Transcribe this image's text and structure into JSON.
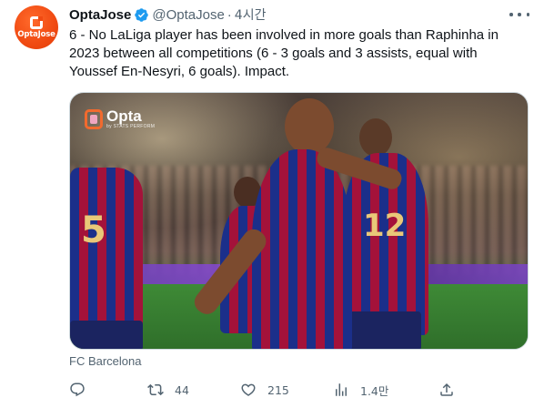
{
  "tweet": {
    "author": {
      "display_name": "OptaJose",
      "handle": "@OptaJose",
      "avatar_label": "OptaJose",
      "verified": true
    },
    "separator": "·",
    "time": "4시간",
    "text": "6 - No LaLiga player has been involved in more goals than Raphinha in 2023 between all competitions (6 - 3 goals and 3 assists, equal with Youssef En-Nesyri, 6 goals). Impact.",
    "media": {
      "logo_text": "Opta",
      "logo_sub": "by STATS PERFORM",
      "caption": "FC Barcelona"
    },
    "actions": {
      "reply": {
        "icon": "reply-icon",
        "count": ""
      },
      "retweet": {
        "icon": "retweet-icon",
        "count": "44"
      },
      "like": {
        "icon": "heart-icon",
        "count": "215"
      },
      "views": {
        "icon": "views-icon",
        "count": "1.4만"
      },
      "share": {
        "icon": "share-icon",
        "count": ""
      }
    }
  },
  "colors": {
    "text_primary": "#0f1419",
    "text_secondary": "#536471",
    "verified_blue": "#1d9bf0",
    "opta_orange": "#f04a12"
  }
}
